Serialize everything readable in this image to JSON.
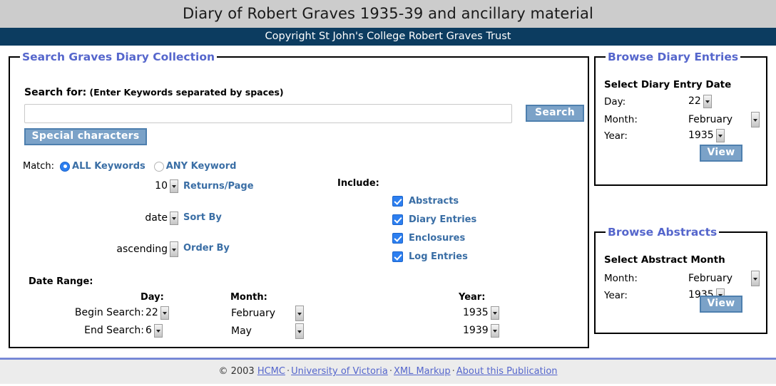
{
  "header": {
    "title": "Diary of Robert Graves 1935-39 and ancillary material",
    "copyright": "Copyright St John's College Robert Graves Trust"
  },
  "search_panel": {
    "legend": "Search Graves Diary Collection",
    "search_for_label": "Search for:",
    "search_for_hint": "(Enter Keywords separated by spaces)",
    "query_value": "",
    "query_placeholder": "",
    "search_button": "Search",
    "special_characters_button": "Special characters",
    "match": {
      "label": "Match:",
      "options": [
        {
          "label": "ALL Keywords",
          "selected": true
        },
        {
          "label": "ANY Keyword",
          "selected": false
        }
      ]
    },
    "returns_per_page": {
      "value": "10",
      "label": "Returns/Page"
    },
    "sort_by": {
      "value": "date",
      "label": "Sort By"
    },
    "order_by": {
      "value": "ascending",
      "label": "Order By"
    },
    "include": {
      "label": "Include:",
      "items": [
        {
          "label": "Abstracts",
          "checked": true
        },
        {
          "label": "Diary Entries",
          "checked": true
        },
        {
          "label": "Enclosures",
          "checked": true
        },
        {
          "label": "Log Entries",
          "checked": true
        }
      ]
    },
    "date_range": {
      "title": "Date Range:",
      "columns": {
        "day": "Day:",
        "month": "Month:",
        "year": "Year:"
      },
      "rows": [
        {
          "label": "Begin Search:",
          "day": "22",
          "month": "February",
          "year": "1935"
        },
        {
          "label": "End Search:",
          "day": "6",
          "month": "May",
          "year": "1939"
        }
      ]
    }
  },
  "browse_entries_panel": {
    "legend": "Browse Diary Entries",
    "heading": "Select Diary Entry Date",
    "day_label": "Day:",
    "day_value": "22",
    "month_label": "Month:",
    "month_value": "February",
    "year_label": "Year:",
    "year_value": "1935",
    "view_button": "View"
  },
  "browse_abstracts_panel": {
    "legend": "Browse Abstracts",
    "heading": "Select Abstract Month",
    "month_label": "Month:",
    "month_value": "February",
    "year_label": "Year:",
    "year_value": "1935",
    "view_button": "View"
  },
  "footer": {
    "copyright": "© 2003",
    "links": [
      {
        "text": "HCMC"
      },
      {
        "text": "University of Victoria"
      },
      {
        "text": "XML Markup"
      },
      {
        "text": "About this Publication"
      }
    ],
    "separator": "·"
  },
  "colors": {
    "title_band": "#cccccc",
    "copyright_band": "#0c3c60",
    "legend_text": "#5566cc",
    "label_blue": "#3a6ea5",
    "button_fill": "#7ba2c8",
    "button_border": "#4e7fae",
    "control_accent": "#2d7ff0",
    "footer_band": "#ececec",
    "footer_link": "#5566cc"
  }
}
